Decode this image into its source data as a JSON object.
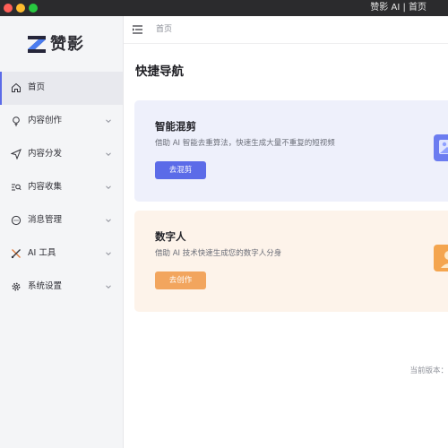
{
  "window": {
    "title": "赞影 AI | 首页"
  },
  "brand": {
    "name": "赞影"
  },
  "sidebar": {
    "items": [
      {
        "label": "首页",
        "icon": "home-icon",
        "active": true,
        "expandable": false
      },
      {
        "label": "内容创作",
        "icon": "lightbulb-icon",
        "active": false,
        "expandable": true
      },
      {
        "label": "内容分发",
        "icon": "send-icon",
        "active": false,
        "expandable": true
      },
      {
        "label": "内容收集",
        "icon": "search-list-icon",
        "active": false,
        "expandable": true
      },
      {
        "label": "消息管理",
        "icon": "chat-icon",
        "active": false,
        "expandable": true
      },
      {
        "label": "AI 工具",
        "icon": "tools-icon",
        "active": false,
        "expandable": true
      },
      {
        "label": "系统设置",
        "icon": "gear-icon",
        "active": false,
        "expandable": true
      }
    ]
  },
  "header": {
    "breadcrumb": "首页"
  },
  "main": {
    "section_title": "快捷导航",
    "cards": [
      {
        "title": "智能混剪",
        "desc": "借助 AI 智能去重算法，快速生成大量不重复的短视频",
        "button": "去混剪",
        "accent": "#5b6be8"
      },
      {
        "title": "数字人",
        "desc": "借助 AI 技术快速生成您的数字人分身",
        "button": "去创作",
        "accent": "#f2a55e"
      }
    ],
    "version_label": "当前版本："
  }
}
